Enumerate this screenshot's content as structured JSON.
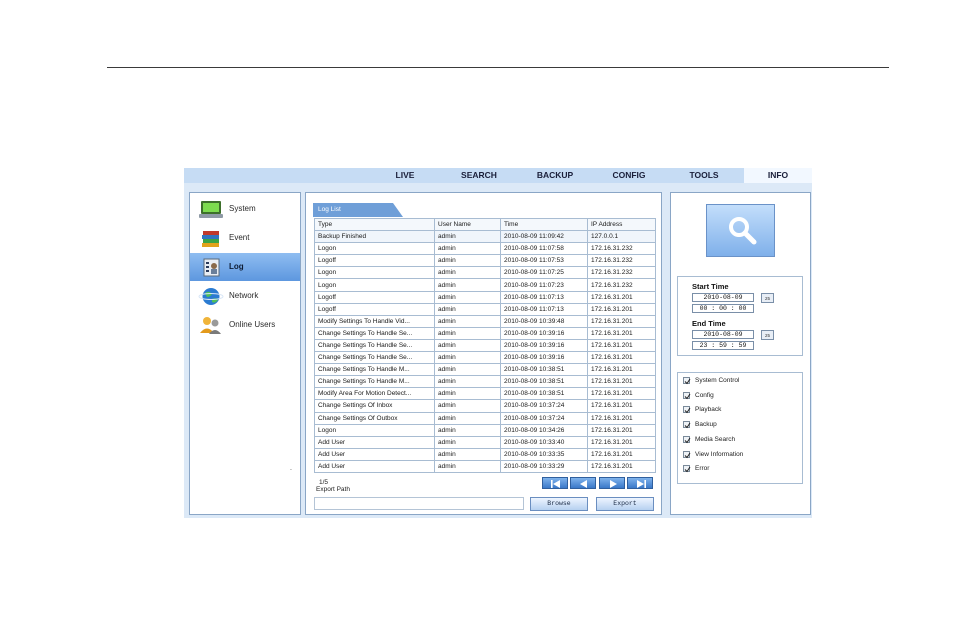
{
  "nav": {
    "tabs": [
      {
        "label": "LIVE"
      },
      {
        "label": "SEARCH"
      },
      {
        "label": "BACKUP"
      },
      {
        "label": "CONFIG"
      },
      {
        "label": "TOOLS"
      },
      {
        "label": "INFO",
        "active": true
      }
    ]
  },
  "sidebar": {
    "items": [
      {
        "label": "System",
        "icon": "monitor-icon"
      },
      {
        "label": "Event",
        "icon": "books-icon"
      },
      {
        "label": "Log",
        "icon": "log-icon",
        "active": true
      },
      {
        "label": "Network",
        "icon": "globe-icon"
      },
      {
        "label": "Online Users",
        "icon": "users-icon"
      }
    ],
    "footer_dot": "."
  },
  "log": {
    "tab_label": "Log List",
    "columns": [
      "Type",
      "User Name",
      "Time",
      "IP Address"
    ],
    "rows": [
      [
        "Backup Finished",
        "admin",
        "2010-08-09 11:09:42",
        "127.0.0.1"
      ],
      [
        "Logon",
        "admin",
        "2010-08-09 11:07:58",
        "172.16.31.232"
      ],
      [
        "Logoff",
        "admin",
        "2010-08-09 11:07:53",
        "172.16.31.232"
      ],
      [
        "Logon",
        "admin",
        "2010-08-09 11:07:25",
        "172.16.31.232"
      ],
      [
        "Logon",
        "admin",
        "2010-08-09 11:07:23",
        "172.16.31.232"
      ],
      [
        "Logoff",
        "admin",
        "2010-08-09 11:07:13",
        "172.16.31.201"
      ],
      [
        "Logoff",
        "admin",
        "2010-08-09 11:07:13",
        "172.16.31.201"
      ],
      [
        "Modify Settings To Handle Vid...",
        "admin",
        "2010-08-09 10:39:48",
        "172.16.31.201"
      ],
      [
        "Change Settings To Handle Se...",
        "admin",
        "2010-08-09 10:39:16",
        "172.16.31.201"
      ],
      [
        "Change Settings To Handle Se...",
        "admin",
        "2010-08-09 10:39:16",
        "172.16.31.201"
      ],
      [
        "Change Settings To Handle Se...",
        "admin",
        "2010-08-09 10:39:16",
        "172.16.31.201"
      ],
      [
        "Change Settings To Handle M...",
        "admin",
        "2010-08-09 10:38:51",
        "172.16.31.201"
      ],
      [
        "Change Settings To Handle M...",
        "admin",
        "2010-08-09 10:38:51",
        "172.16.31.201"
      ],
      [
        "Modify Area For Motion Detect...",
        "admin",
        "2010-08-09 10:38:51",
        "172.16.31.201"
      ],
      [
        "Change Settings Of Inbox",
        "admin",
        "2010-08-09 10:37:24",
        "172.16.31.201"
      ],
      [
        "Change Settings Of Outbox",
        "admin",
        "2010-08-09 10:37:24",
        "172.16.31.201"
      ],
      [
        "Logon",
        "admin",
        "2010-08-09 10:34:26",
        "172.16.31.201"
      ],
      [
        "Add User",
        "admin",
        "2010-08-09 10:33:40",
        "172.16.31.201"
      ],
      [
        "Add User",
        "admin",
        "2010-08-09 10:33:35",
        "172.16.31.201"
      ],
      [
        "Add User",
        "admin",
        "2010-08-09 10:33:29",
        "172.16.31.201"
      ]
    ],
    "page_indicator": "1/5",
    "export_path_label": "Export Path",
    "export_path_value": "",
    "browse_label": "Browse",
    "export_label": "Export"
  },
  "search": {
    "start_time_label": "Start Time",
    "start_date": "2010-08-09",
    "start_clock": "00 : 00 : 00",
    "end_time_label": "End Time",
    "end_date": "2010-08-09",
    "end_clock": "23 : 59 : 59",
    "calendar_label": "25",
    "filters": [
      {
        "label": "System Control",
        "checked": true
      },
      {
        "label": "Config",
        "checked": true
      },
      {
        "label": "Playback",
        "checked": true
      },
      {
        "label": "Backup",
        "checked": true
      },
      {
        "label": "Media Search",
        "checked": true
      },
      {
        "label": "View Information",
        "checked": true
      },
      {
        "label": "Error",
        "checked": true
      }
    ]
  },
  "colors": {
    "accent": "#5d97df",
    "nav_bg": "#c6dcf4",
    "panel_border": "#8aa6c6"
  }
}
